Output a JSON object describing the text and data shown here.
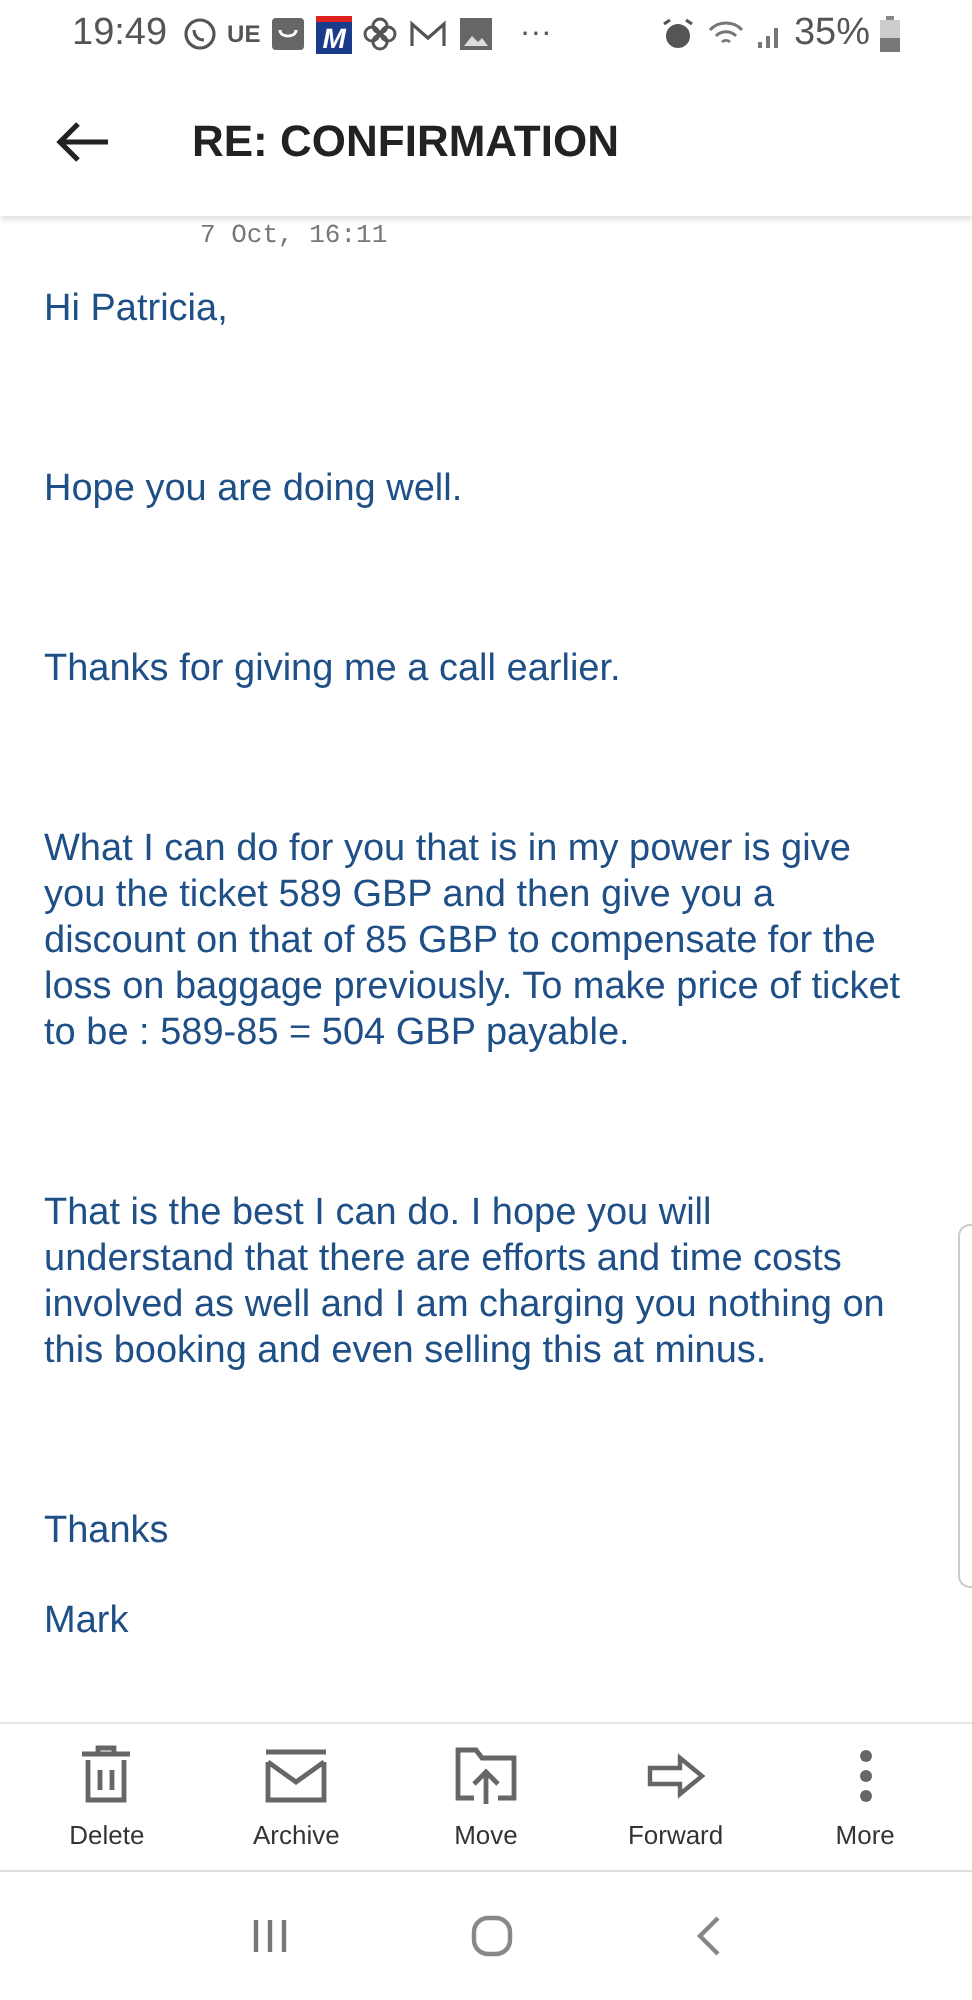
{
  "status_bar": {
    "time": "19:49",
    "app_badges": [
      "UE",
      "M"
    ],
    "more": "···",
    "battery": "35%"
  },
  "header": {
    "title": "RE: CONFIRMATION"
  },
  "message": {
    "date": "7 Oct, 16:11",
    "paragraphs": [
      {
        "text": "Hi Patricia,",
        "kind": "block"
      },
      {
        "text": "Hope you are doing well.",
        "kind": "block"
      },
      {
        "text": "Thanks for giving me a call earlier.",
        "kind": "block"
      },
      {
        "text": "What I can do for you that is in my power is give you the ticket 589 GBP and then give you a discount on that of 85 GBP to compensate for the loss on baggage previously. To make price of ticket to be : 589-85 = 504 GBP payable.",
        "kind": "block"
      },
      {
        "text": "That is the best I can do. I hope you will understand that there are efforts and time costs involved as well and I am charging you nothing on this booking and even selling this at minus.",
        "kind": "block"
      },
      {
        "text": "Thanks",
        "kind": "line"
      },
      {
        "text": "Mark",
        "kind": "line"
      }
    ]
  },
  "toolbar": [
    {
      "label": "Delete",
      "kind": "delete"
    },
    {
      "label": "Archive",
      "kind": "archive"
    },
    {
      "label": "Move",
      "kind": "move"
    },
    {
      "label": "Forward",
      "kind": "forward"
    },
    {
      "label": "More",
      "kind": "more"
    }
  ]
}
